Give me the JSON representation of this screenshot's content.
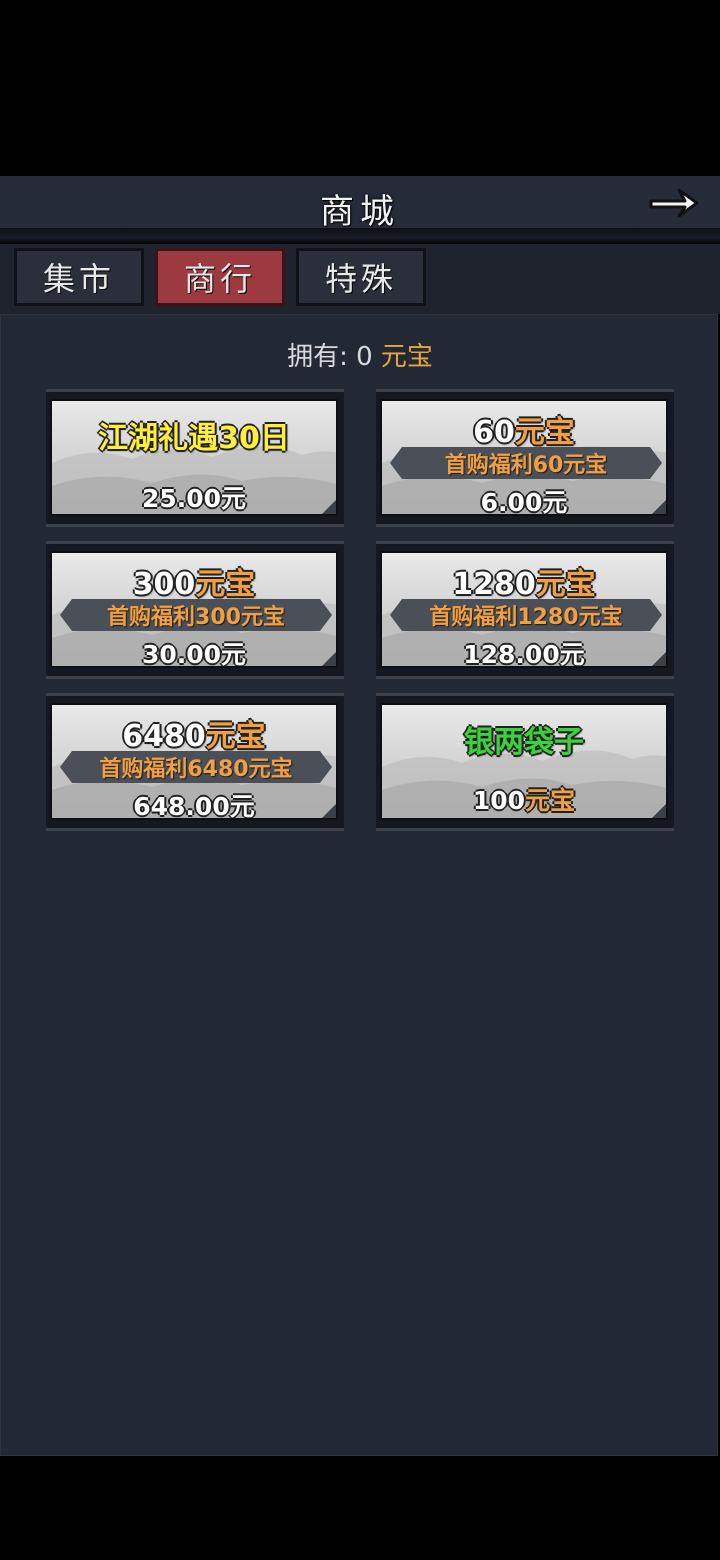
{
  "header": {
    "title": "商城"
  },
  "tabs": [
    {
      "label": "集市",
      "active": false
    },
    {
      "label": "商行",
      "active": true
    },
    {
      "label": "特殊",
      "active": false
    }
  ],
  "balance": {
    "prefix": "拥有:",
    "amount": "0",
    "currency": "元宝"
  },
  "products": [
    {
      "title": "江湖礼遇30日",
      "price": "25.00元"
    },
    {
      "amount": "60",
      "unit": "元宝",
      "bonus": "首购福利60元宝",
      "price": "6.00元"
    },
    {
      "amount": "300",
      "unit": "元宝",
      "bonus": "首购福利300元宝",
      "price": "30.00元"
    },
    {
      "amount": "1280",
      "unit": "元宝",
      "bonus": "首购福利1280元宝",
      "price": "128.00元"
    },
    {
      "amount": "6480",
      "unit": "元宝",
      "bonus": "首购福利6480元宝",
      "price": "648.00元"
    },
    {
      "title": "银两袋子",
      "price_amount": "100",
      "price_unit": "元宝"
    }
  ],
  "colors": {
    "accent_tab": "#9c3a40",
    "gold": "#e8a53c",
    "yellow": "#ffee3a",
    "green": "#3bd23b",
    "background": "#232835"
  }
}
